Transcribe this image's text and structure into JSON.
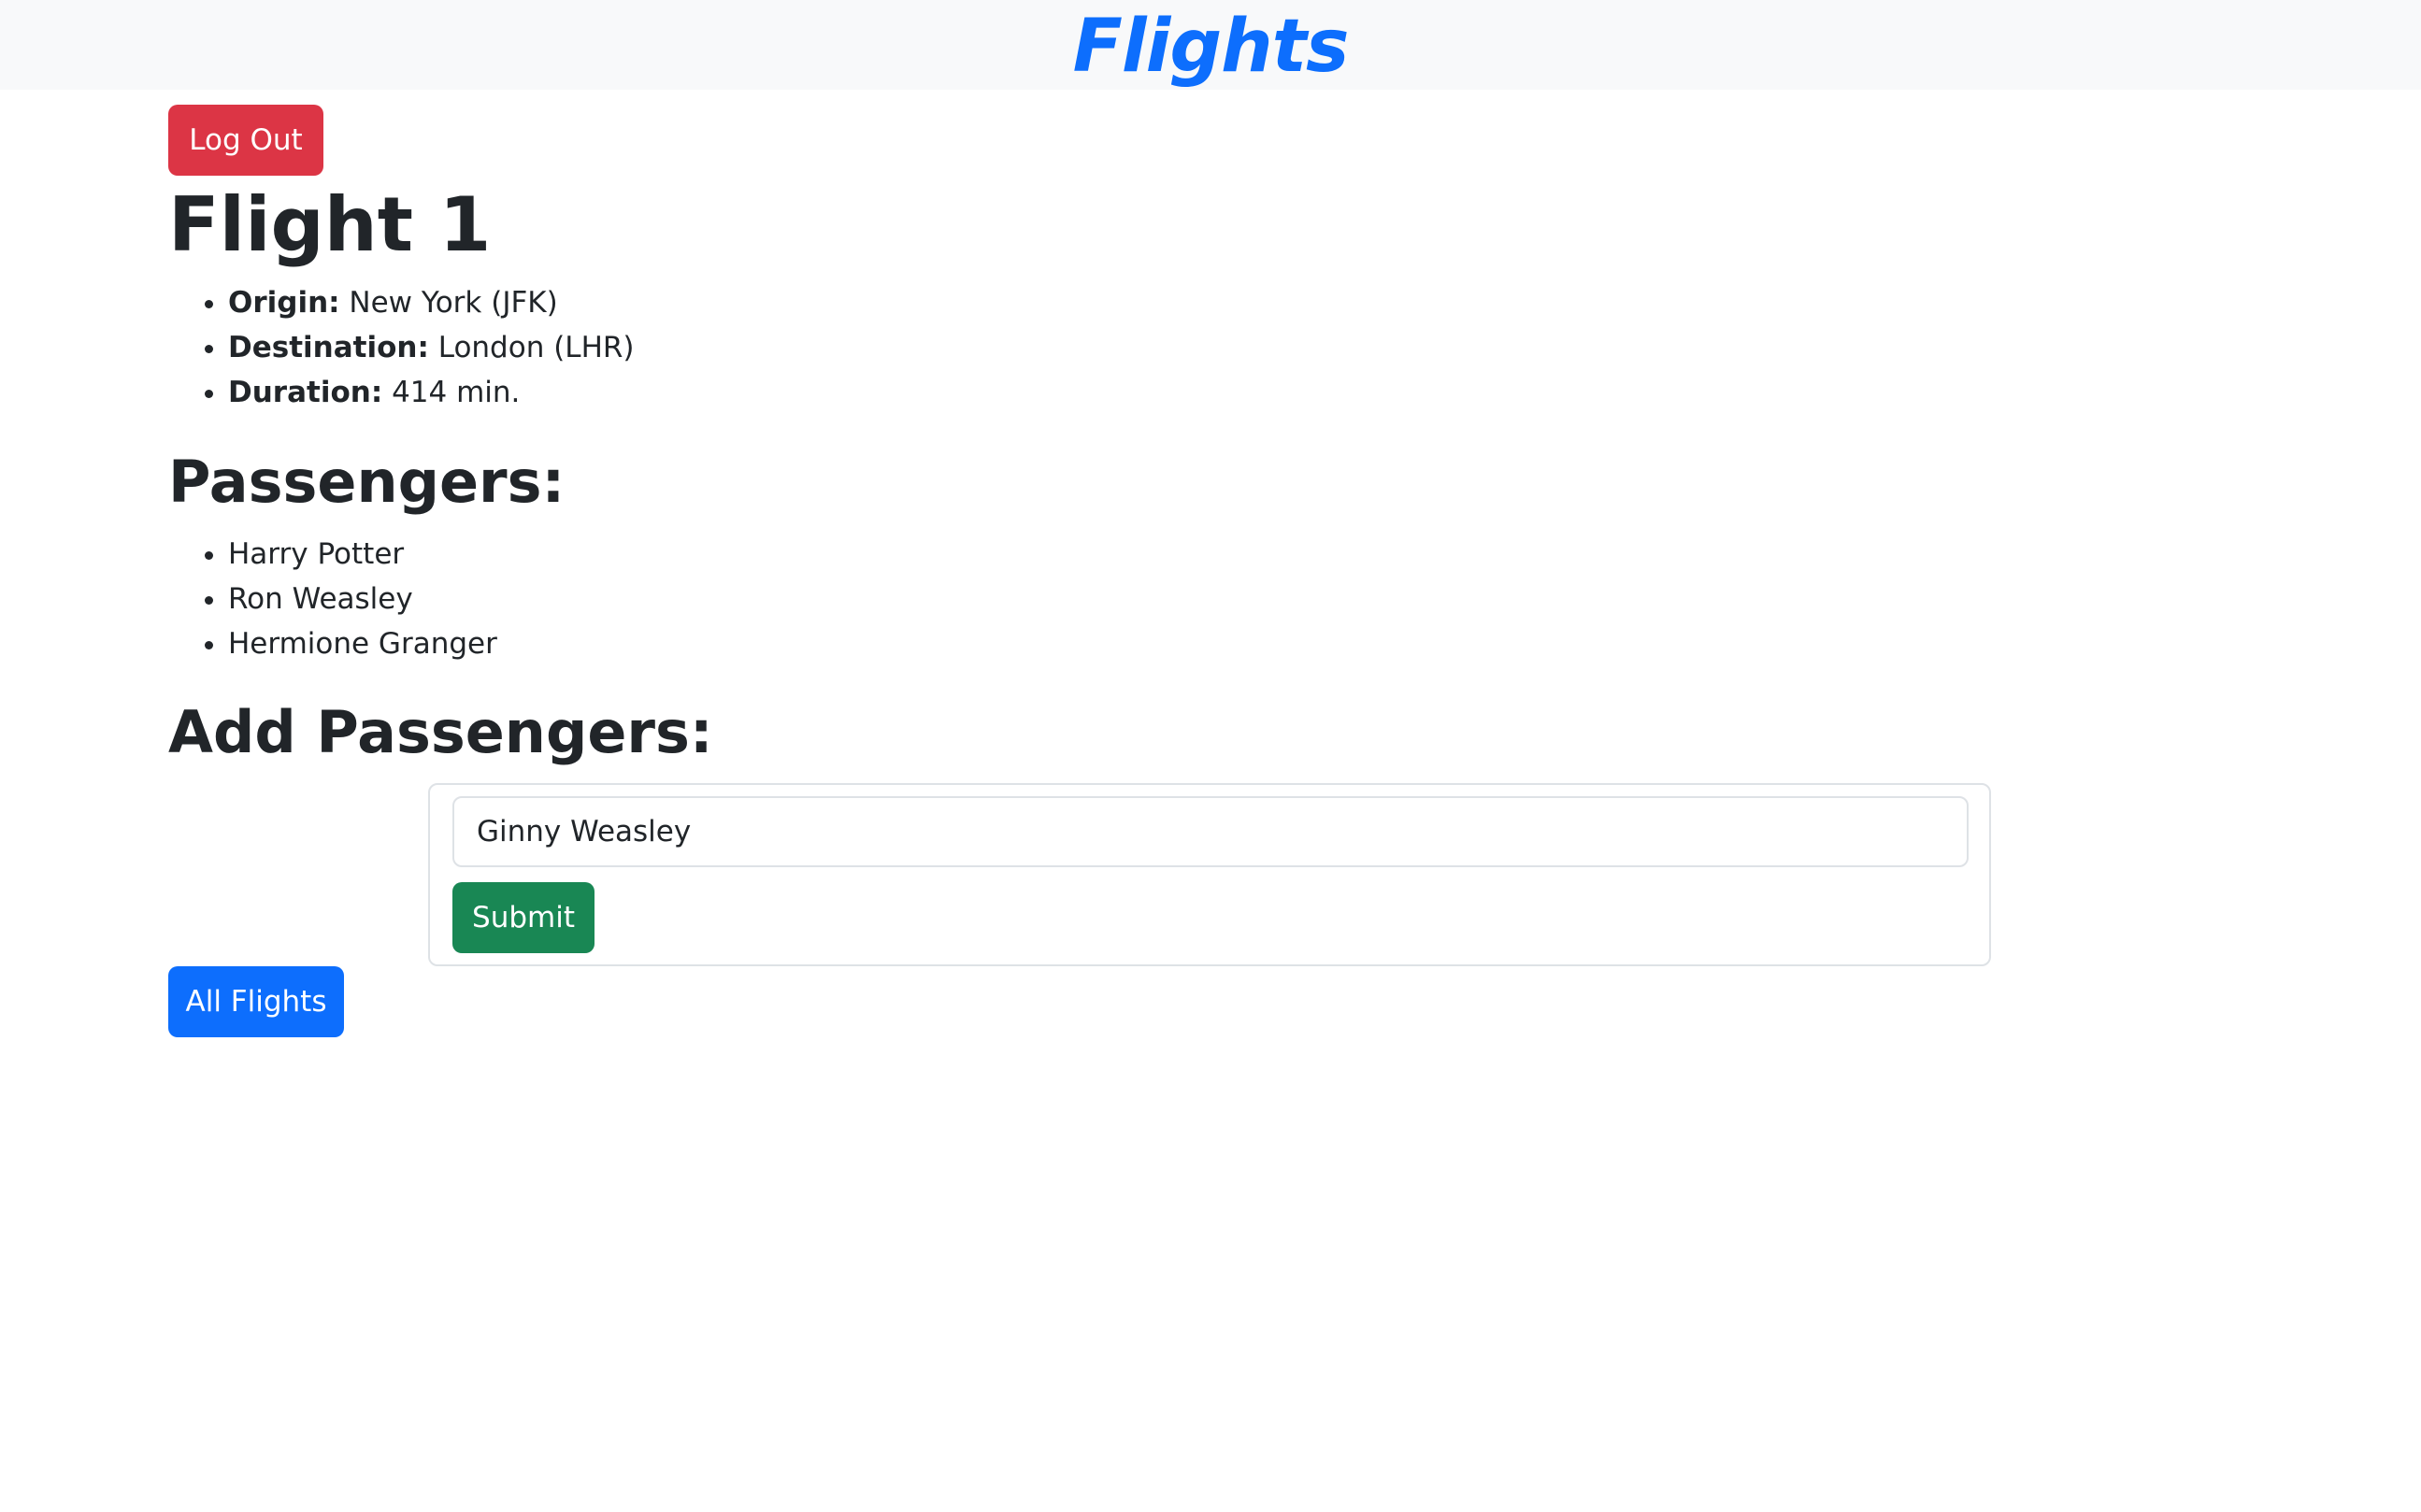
{
  "navbar": {
    "brand": "Flights"
  },
  "auth": {
    "logout_label": "Log Out"
  },
  "flight": {
    "title": "Flight 1",
    "details": [
      {
        "label": "Origin:",
        "value": " New York (JFK)"
      },
      {
        "label": "Destination:",
        "value": " London (LHR)"
      },
      {
        "label": "Duration:",
        "value": " 414 min."
      }
    ]
  },
  "passengers": {
    "heading": "Passengers:",
    "items": [
      "Harry Potter",
      "Ron Weasley",
      "Hermione Granger"
    ]
  },
  "add_passenger": {
    "heading": "Add Passengers:",
    "input_value": "Ginny Weasley",
    "submit_label": "Submit"
  },
  "navigation": {
    "all_flights_label": "All Flights"
  },
  "colors": {
    "brand": "#0d6efd",
    "danger": "#dc3545",
    "success": "#198754",
    "primary": "#0d6efd"
  }
}
